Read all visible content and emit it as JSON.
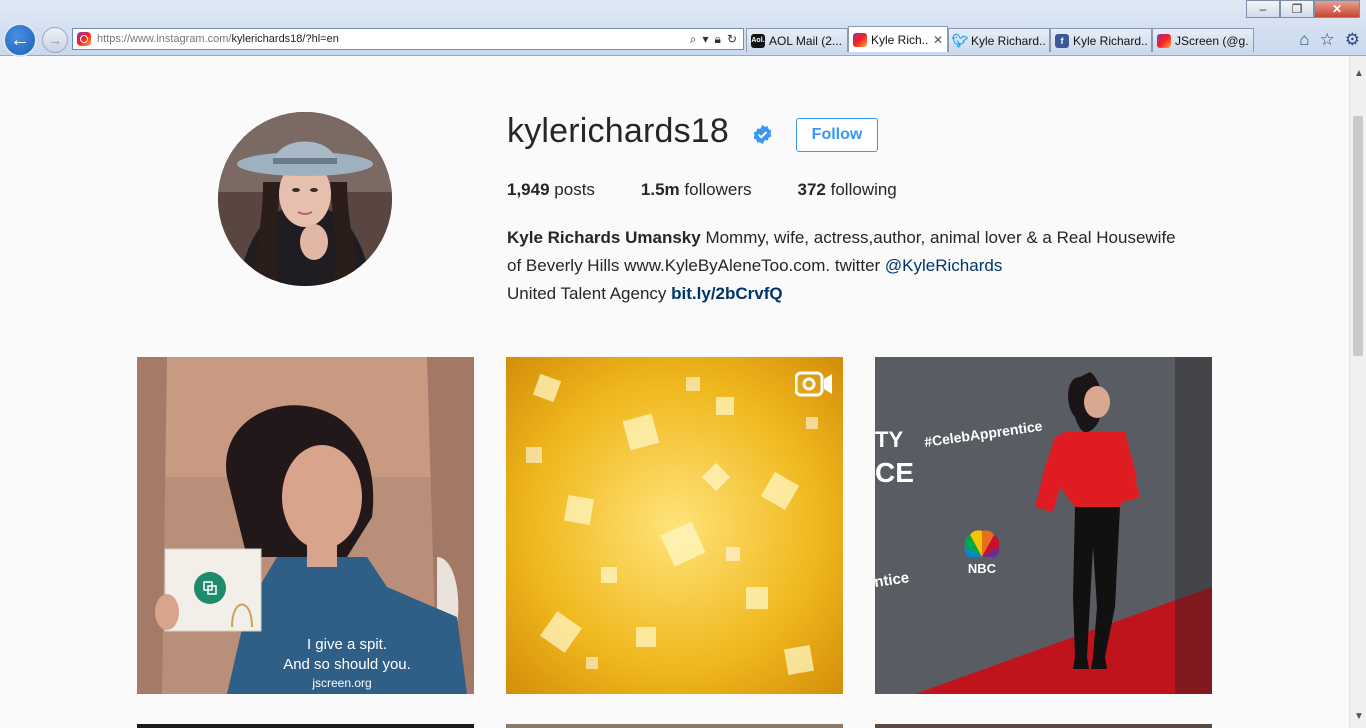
{
  "browser": {
    "url_prefix": "https://www.instagram.com/",
    "url_rest": "kylerichards18/?hl=en",
    "tabs": [
      {
        "label": "AOL Mail (2...",
        "icon": "aol-icon"
      },
      {
        "label": "Kyle Rich...",
        "icon": "instagram-icon",
        "active": true
      },
      {
        "label": "Kyle Richard...",
        "icon": "twitter-icon"
      },
      {
        "label": "Kyle Richard...",
        "icon": "facebook-icon"
      },
      {
        "label": "JScreen (@g...",
        "icon": "instagram-icon"
      }
    ]
  },
  "profile": {
    "username": "kylerichards18",
    "follow_label": "Follow",
    "posts_count": "1,949",
    "posts_label": "posts",
    "followers_count": "1.5m",
    "followers_label": "followers",
    "following_count": "372",
    "following_label": "following",
    "full_name": "Kyle Richards Umansky",
    "bio_text_1": "Mommy, wife, actress,author, animal lover & a Real Housewife of Beverly Hills www.KyleByAleneToo.com. twitter",
    "bio_mention": "@KyleRichards",
    "bio_text_2": "United Talent Agency",
    "bio_link": "bit.ly/2bCrvfQ"
  },
  "posts": [
    {
      "caption_line1": "I give a spit.",
      "caption_line2": "And so should you.",
      "caption_line3": "jscreen.org"
    },
    {
      "type": "video"
    },
    {
      "sign_tag": "#CelebApprentice",
      "sign_logo": "NBC"
    }
  ],
  "colors": {
    "accent": "#3897f0",
    "link": "#003569",
    "text": "#262626",
    "background": "#fafafa"
  }
}
